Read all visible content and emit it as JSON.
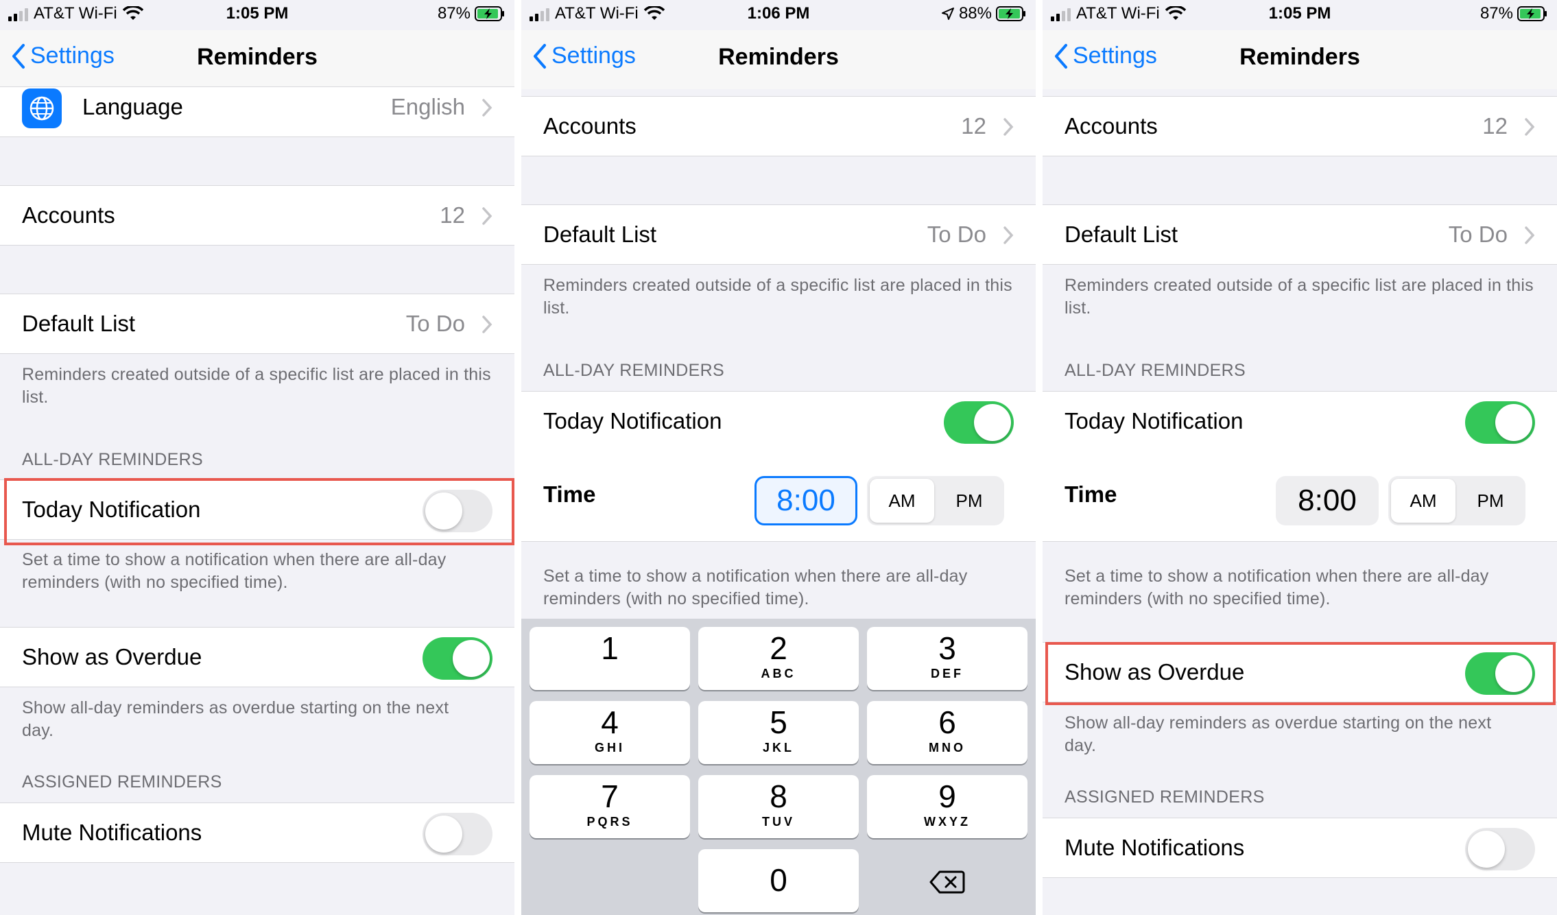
{
  "colors": {
    "accent": "#0a7aff",
    "toggle_on": "#34c759",
    "highlight": "#e8584e"
  },
  "panels": [
    {
      "status": {
        "carrier": "AT&T Wi-Fi",
        "time": "1:05 PM",
        "battery": "87%"
      },
      "nav": {
        "back": "Settings",
        "title": "Reminders"
      },
      "language": {
        "label": "Language",
        "value": "English",
        "icon": "globe-icon"
      },
      "accounts": {
        "label": "Accounts",
        "value": "12"
      },
      "default_list": {
        "label": "Default List",
        "value": "To Do",
        "footer": "Reminders created outside of a specific list are placed in this list."
      },
      "all_day_header": "ALL-DAY REMINDERS",
      "today_notification": {
        "label": "Today Notification",
        "on": false,
        "footer": "Set a time to show a notification when there are all-day reminders (with no specified time)."
      },
      "show_overdue": {
        "label": "Show as Overdue",
        "on": true,
        "footer": "Show all-day reminders as overdue starting on the next day."
      },
      "assigned_header": "ASSIGNED REMINDERS",
      "mute": {
        "label": "Mute Notifications",
        "on": false
      }
    },
    {
      "status": {
        "carrier": "AT&T Wi-Fi",
        "time": "1:06 PM",
        "battery": "88%"
      },
      "nav": {
        "back": "Settings",
        "title": "Reminders"
      },
      "accounts": {
        "label": "Accounts",
        "value": "12"
      },
      "default_list": {
        "label": "Default List",
        "value": "To Do",
        "footer": "Reminders created outside of a specific list are placed in this list."
      },
      "all_day_header": "ALL-DAY REMINDERS",
      "today_notification": {
        "label": "Today Notification",
        "on": true,
        "footer": "Set a time to show a notification when there are all-day reminders (with no specified time)."
      },
      "time": {
        "label": "Time",
        "value": "8:00",
        "am": "AM",
        "pm": "PM"
      },
      "keypad": [
        {
          "digit": "1",
          "letters": ""
        },
        {
          "digit": "2",
          "letters": "ABC"
        },
        {
          "digit": "3",
          "letters": "DEF"
        },
        {
          "digit": "4",
          "letters": "GHI"
        },
        {
          "digit": "5",
          "letters": "JKL"
        },
        {
          "digit": "6",
          "letters": "MNO"
        },
        {
          "digit": "7",
          "letters": "PQRS"
        },
        {
          "digit": "8",
          "letters": "TUV"
        },
        {
          "digit": "9",
          "letters": "WXYZ"
        },
        {
          "digit": "0",
          "letters": ""
        }
      ]
    },
    {
      "status": {
        "carrier": "AT&T Wi-Fi",
        "time": "1:05 PM",
        "battery": "87%"
      },
      "nav": {
        "back": "Settings",
        "title": "Reminders"
      },
      "accounts": {
        "label": "Accounts",
        "value": "12"
      },
      "default_list": {
        "label": "Default List",
        "value": "To Do",
        "footer": "Reminders created outside of a specific list are placed in this list."
      },
      "all_day_header": "ALL-DAY REMINDERS",
      "today_notification": {
        "label": "Today Notification",
        "on": true
      },
      "time": {
        "label": "Time",
        "value": "8:00",
        "am": "AM",
        "pm": "PM",
        "footer": "Set a time to show a notification when there are all-day reminders (with no specified time)."
      },
      "show_overdue": {
        "label": "Show as Overdue",
        "on": true,
        "footer": "Show all-day reminders as overdue starting on the next day."
      },
      "assigned_header": "ASSIGNED REMINDERS",
      "mute": {
        "label": "Mute Notifications",
        "on": false
      }
    }
  ]
}
